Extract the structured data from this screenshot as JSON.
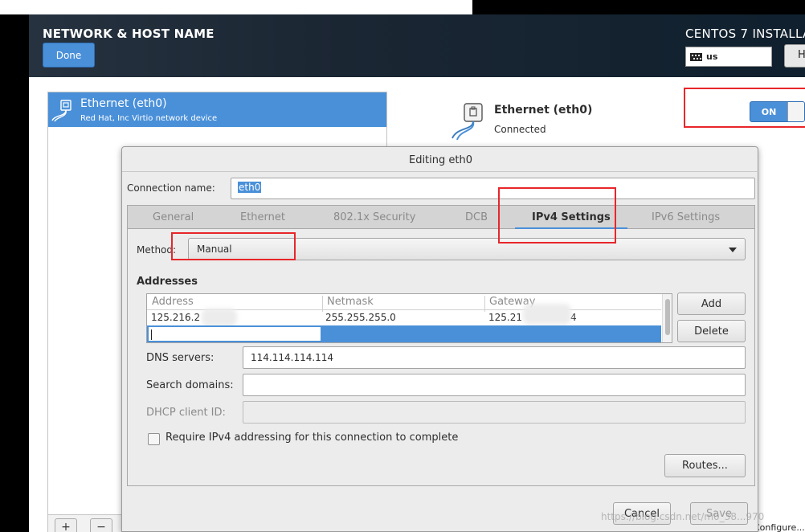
{
  "header": {
    "title": "NETWORK & HOST NAME",
    "done_label": "Done",
    "installer_title": "CENTOS 7 INSTALLA",
    "keyboard_layout": "us",
    "help_label": "H"
  },
  "device_list": {
    "items": [
      {
        "name": "Ethernet (eth0)",
        "description": "Red Hat, Inc Virtio network device"
      }
    ],
    "add_label": "+",
    "remove_label": "−"
  },
  "device_detail": {
    "name": "Ethernet (eth0)",
    "status": "Connected",
    "toggle_label": "ON",
    "configure_label": "Configure..."
  },
  "dialog": {
    "title": "Editing eth0",
    "connection_name_label": "Connection name:",
    "connection_name_value": "eth0",
    "tabs": [
      {
        "label": "General"
      },
      {
        "label": "Ethernet"
      },
      {
        "label": "802.1x Security"
      },
      {
        "label": "DCB"
      },
      {
        "label": "IPv4 Settings",
        "active": true
      },
      {
        "label": "IPv6 Settings"
      }
    ],
    "method_label": "Method:",
    "method_value": "Manual",
    "addresses_label": "Addresses",
    "addresses_columns": [
      "Address",
      "Netmask",
      "Gateway"
    ],
    "addresses_rows": [
      [
        "125.216.2",
        "255.255.255.0",
        "125.21"
      ]
    ],
    "addresses_row_tail": "4",
    "add_button": "Add",
    "delete_button": "Delete",
    "dns_label": "DNS servers:",
    "dns_value": "114.114.114.114",
    "search_label": "Search domains:",
    "search_value": "",
    "dhcp_label": "DHCP client ID:",
    "dhcp_value": "",
    "require_ipv4_label": "Require IPv4 addressing for this connection to complete",
    "routes_button": "Routes...",
    "cancel_button": "Cancel",
    "save_button": "Save"
  },
  "watermark": "https://blog.csdn.net/m0_38...970",
  "colors": {
    "accent": "#4a90d9",
    "highlight_box": "#e8262a",
    "header_bg": "#1b2633"
  }
}
